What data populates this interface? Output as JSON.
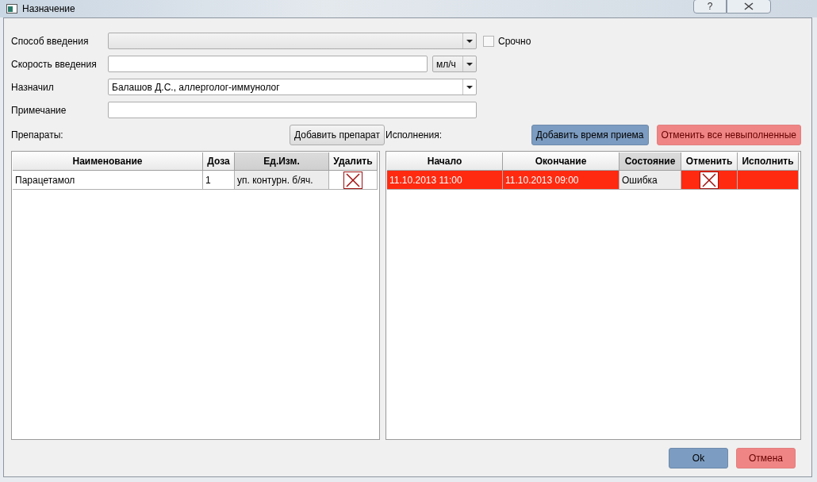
{
  "window": {
    "title": "Назначение",
    "help": "?"
  },
  "form": {
    "route": {
      "label": "Способ введения"
    },
    "urgent": {
      "label": "Срочно",
      "checked": false
    },
    "speed": {
      "label": "Скорость введения",
      "unit": "мл/ч"
    },
    "prescriber": {
      "label": "Назначил",
      "value": "Балашов Д.С., аллерголог-иммунолог"
    },
    "note": {
      "label": "Примечание"
    }
  },
  "drugs": {
    "label": "Препараты:",
    "add_button": "Добавить препарат",
    "columns": [
      {
        "title": "Наименование",
        "kind": "text",
        "sorted": false
      },
      {
        "title": "Доза",
        "kind": "text",
        "sorted": false
      },
      {
        "title": "Ед.Изм.",
        "kind": "text",
        "sorted": true
      },
      {
        "title": "Удалить",
        "kind": "delete",
        "sorted": false
      }
    ],
    "rows": [
      {
        "cells": [
          "Парацетамол",
          "1",
          "уп. контурн. б/яч."
        ],
        "error": false
      }
    ]
  },
  "executions": {
    "label": "Исполнения:",
    "add_button": "Добавить время приема",
    "cancel_all_button": "Отменить все невыполненные",
    "columns": [
      {
        "title": "Начало",
        "kind": "text",
        "sorted": false
      },
      {
        "title": "Окончание",
        "kind": "text",
        "sorted": false
      },
      {
        "title": "Состояние",
        "kind": "text",
        "sorted": true
      },
      {
        "title": "Отменить",
        "kind": "delete",
        "sorted": false
      },
      {
        "title": "Исполнить",
        "kind": "empty",
        "sorted": false
      }
    ],
    "rows": [
      {
        "cells": [
          "11.10.2013 11:00",
          "11.10.2013 09:00",
          "Ошибка"
        ],
        "error": true
      }
    ]
  },
  "buttons": {
    "ok": "Ok",
    "cancel": "Отмена"
  }
}
